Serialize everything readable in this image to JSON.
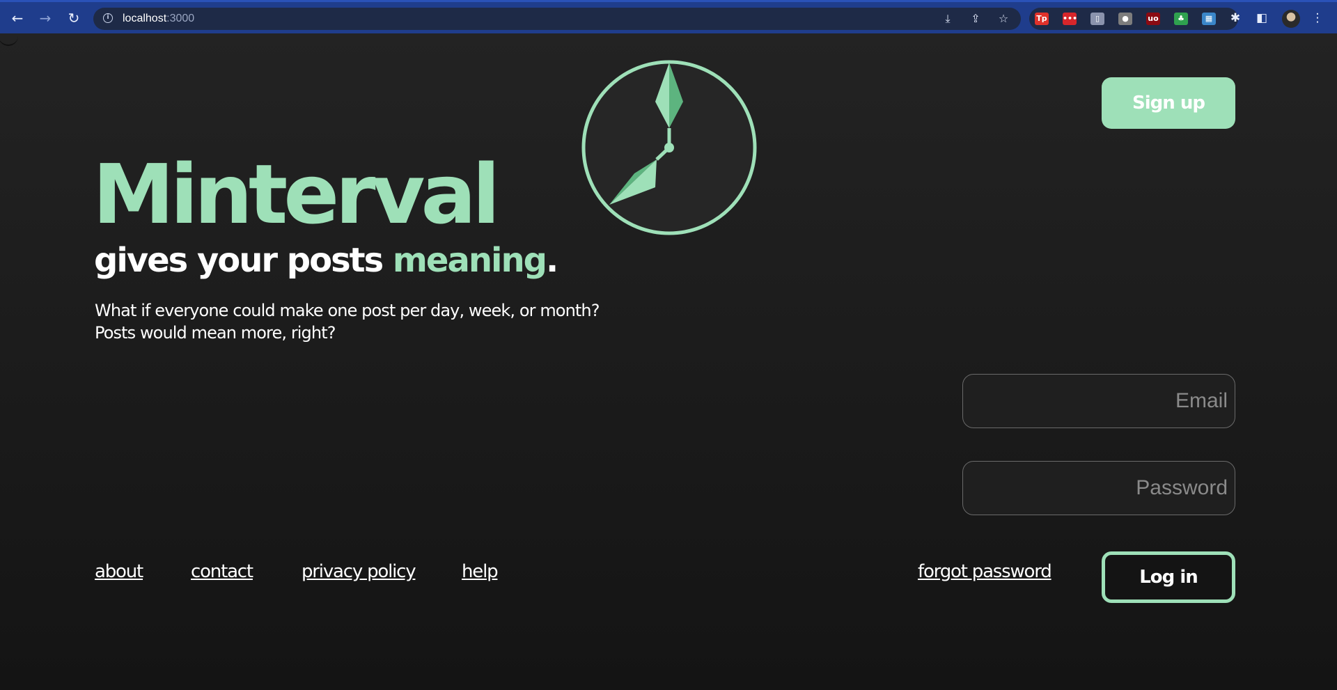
{
  "browser": {
    "url_host": "localhost",
    "url_port": ":3000",
    "nav": {
      "back_icon": "←",
      "forward_icon": "→",
      "reload_icon": "↻"
    },
    "omnibox_icons": [
      "install-icon",
      "share-icon",
      "star-icon"
    ],
    "extensions": [
      {
        "name": "tp-extension-icon",
        "glyph": "Tp",
        "color": "#e0322b"
      },
      {
        "name": "password-manager-icon",
        "glyph": "•••",
        "color": "#d7262b"
      },
      {
        "name": "device-icon",
        "glyph": "▯",
        "color": "#8a93ad"
      },
      {
        "name": "mouse-extension-icon",
        "glyph": "●",
        "color": "#7d7d7d"
      },
      {
        "name": "ublock-icon",
        "glyph": "uo",
        "color": "#8b0a12"
      },
      {
        "name": "tree-extension-icon",
        "glyph": "♣",
        "color": "#2fa14f"
      },
      {
        "name": "grid-extension-icon",
        "glyph": "▦",
        "color": "#3a86c9"
      },
      {
        "name": "puzzle-icon",
        "glyph": "✱",
        "color": "transparent"
      }
    ]
  },
  "colors": {
    "accent": "#9ee0b8",
    "background": "#151515"
  },
  "hero": {
    "title": "Minterval",
    "tagline_prefix": "gives your posts ",
    "tagline_accent": "meaning",
    "tagline_suffix": ".",
    "description_line1": "What if everyone could make one post per day, week, or month?",
    "description_line2": "Posts would mean more, right?"
  },
  "auth": {
    "signup_label": "Sign up",
    "email_placeholder": "Email",
    "password_placeholder": "Password",
    "forgot_password_label": "forgot password",
    "login_label": "Log in"
  },
  "footer": {
    "about": "about",
    "contact": "contact",
    "privacy": "privacy policy",
    "help": "help"
  }
}
